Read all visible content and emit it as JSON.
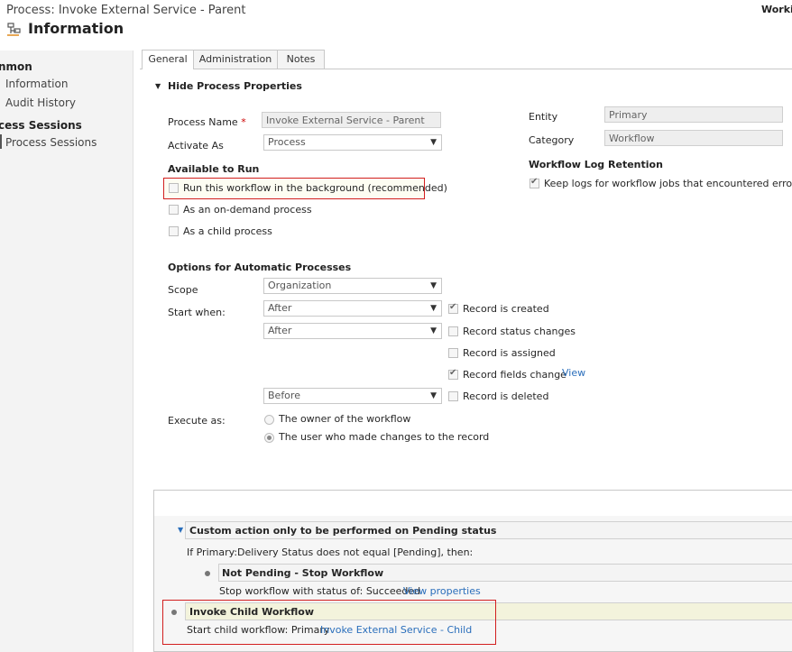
{
  "header": {
    "title": "Process: Invoke External Service - Parent",
    "status_truncated": "Workin",
    "section": "Information"
  },
  "leftnav": {
    "group1": "nmon",
    "items1": [
      "Information",
      "Audit History"
    ],
    "group2": "cess Sessions",
    "items2": [
      "Process Sessions"
    ]
  },
  "tabs": [
    "General",
    "Administration",
    "Notes"
  ],
  "properties": {
    "toggle_label": "Hide Process Properties",
    "process_name_label": "Process Name",
    "process_name_value": "Invoke External Service - Parent",
    "activate_as_label": "Activate As",
    "activate_as_value": "Process",
    "entity_label": "Entity",
    "entity_value": "Primary",
    "category_label": "Category",
    "category_value": "Workflow",
    "log_retention_heading": "Workflow Log Retention",
    "keep_logs_label": "Keep logs for workflow jobs that encountered errors",
    "available_heading": "Available to Run",
    "run_background": "Run this workflow in the background (recommended)",
    "on_demand": "As an on-demand process",
    "child_process": "As a child process"
  },
  "options": {
    "heading": "Options for Automatic Processes",
    "scope_label": "Scope",
    "scope_value": "Organization",
    "start_when_label": "Start when:",
    "start_when_1": "After",
    "start_when_2": "After",
    "start_when_3": "Before",
    "record_created": "Record is created",
    "record_status": "Record status changes",
    "record_assigned": "Record is assigned",
    "record_fields": "Record fields change",
    "view_link": "View",
    "record_deleted": "Record is deleted",
    "execute_as_label": "Execute as:",
    "owner_option": "The owner of the workflow",
    "user_option": "The user who made changes to the record"
  },
  "designer": {
    "step1_title": "Custom action only to be performed on Pending status",
    "step1_condition": "If Primary:Delivery Status does not equal [Pending], then:",
    "step2_title": "Not Pending - Stop Workflow",
    "step2_text": "Stop workflow with status of:  Succeeded",
    "step2_link": "View properties",
    "step3_title": "Invoke Child Workflow",
    "step3_text": "Start child workflow:  Primary",
    "step3_link": "Invoke External Service - Child"
  },
  "colors": {
    "highlight_border": "#d21f1f",
    "link": "#2a6ebb",
    "step_yellow": "#f3f3dc"
  }
}
